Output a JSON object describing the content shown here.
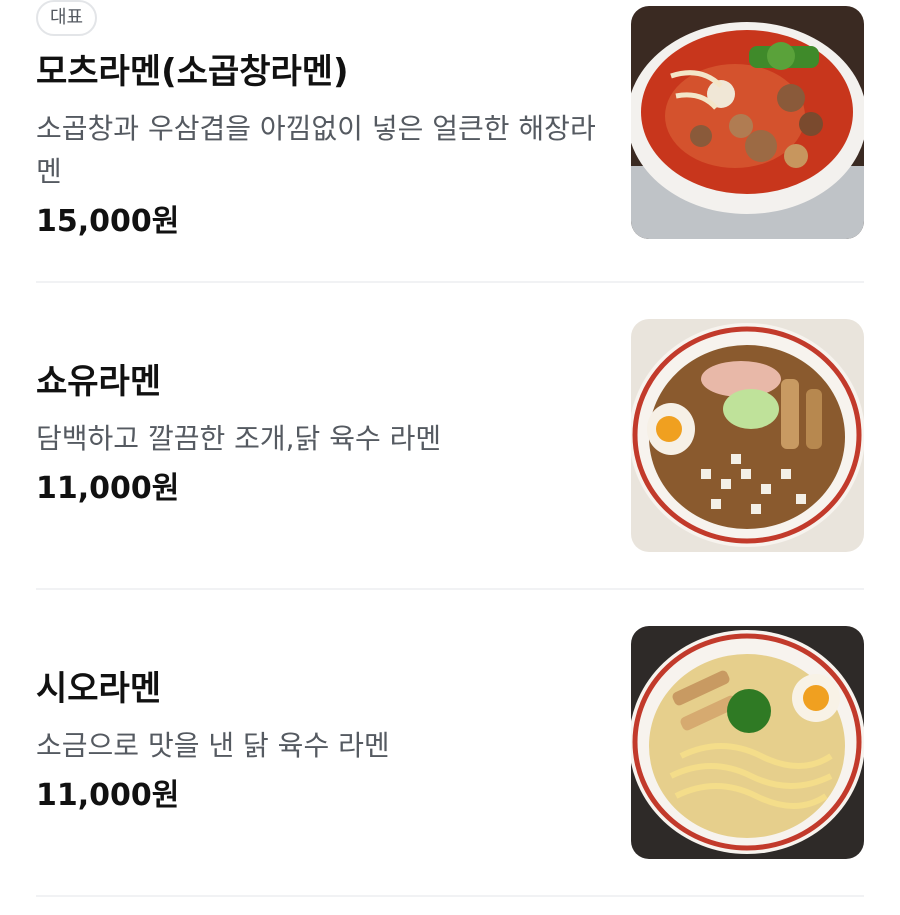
{
  "menu": {
    "items": [
      {
        "badge": "대표",
        "name": "모츠라멘(소곱창라멘)",
        "description": "소곱창과 우삼겹을 아낌없이 넣은 얼큰한 해장라멘",
        "price": "15,000원"
      },
      {
        "name": "쇼유라멘",
        "description": "담백하고 깔끔한 조개,닭 육수 라멘",
        "price": "11,000원"
      },
      {
        "name": "시오라멘",
        "description": "소금으로 맛을 낸 닭 육수 라멘",
        "price": "11,000원"
      }
    ]
  },
  "colors": {
    "text_primary": "#111111",
    "text_secondary": "#555a61",
    "divider": "#f1f2f4",
    "badge_border": "#e3e5e8"
  }
}
